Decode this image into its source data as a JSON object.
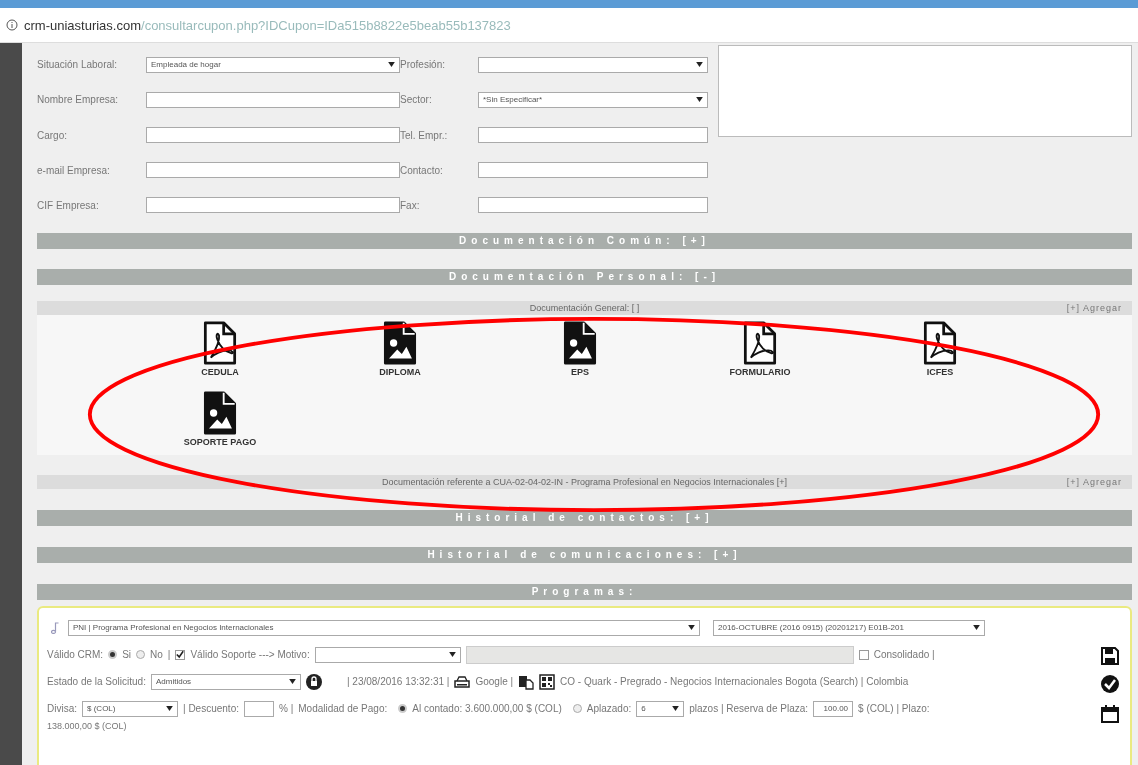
{
  "address_bar": {
    "domain": "crm-uniasturias.com",
    "path": "/consultarcupon.php?IDCupon=IDa515b8822e5beab55b137823"
  },
  "employment_form": {
    "rows": [
      {
        "left": {
          "label": "Situación Laboral:",
          "kind": "select",
          "value": "Empleada de hogar"
        },
        "right": {
          "label": "Profesión:",
          "kind": "select"
        }
      },
      {
        "left": {
          "label": "Nombre Empresa:",
          "kind": "input"
        },
        "right": {
          "label": "Sector:",
          "kind": "select",
          "value": "*Sin Especificar*"
        }
      },
      {
        "left": {
          "label": "Cargo:",
          "kind": "input"
        },
        "right": {
          "label": "Tel. Empr.:",
          "kind": "input"
        }
      },
      {
        "left": {
          "label": "e-mail Empresa:",
          "kind": "input"
        },
        "right": {
          "label": "Contacto:",
          "kind": "input"
        }
      },
      {
        "left": {
          "label": "CIF Empresa:",
          "kind": "input"
        },
        "right": {
          "label": "Fax:",
          "kind": "input"
        }
      }
    ]
  },
  "sections_top": [
    {
      "title": "Documentación Común: [+]"
    },
    {
      "title": "Documentación Personal: [-]"
    }
  ],
  "general_docs": {
    "title": "Documentación General: [ ]",
    "add_link": "[+] Agregar",
    "documents": [
      {
        "name": "CEDULA",
        "kind": "pdf"
      },
      {
        "name": "DIPLOMA",
        "kind": "image"
      },
      {
        "name": "EPS",
        "kind": "image"
      },
      {
        "name": "FORMULARIO",
        "kind": "pdf"
      },
      {
        "name": "ICFES",
        "kind": "pdf"
      },
      {
        "name": "SOPORTE PAGO",
        "kind": "image"
      }
    ]
  },
  "program_docs": {
    "title": "Documentación referente a CUA-02-04-02-IN - Programa Profesional en Negocios Internacionales [+]",
    "add_link": "[+] Agregar"
  },
  "sections_bottom": [
    {
      "title": "Historial de contactos: [+]"
    },
    {
      "title": "Historial de comunicaciones: [+]"
    },
    {
      "title": "Programas:"
    }
  ],
  "program": {
    "program_select": "PNI | Programa Profesional en Negocios Internacionales",
    "period_select": "2016-OCTUBRE (2016 0915) (20201217) E01B-201",
    "valid_crm": {
      "label": "Válido CRM:",
      "options": [
        {
          "label": "Si",
          "selected": true
        },
        {
          "label": "No",
          "selected": false
        }
      ]
    },
    "separator": "|",
    "valid_support": {
      "label": "Válido Soporte ---> Motivo:",
      "checked": true
    },
    "consolidated": {
      "label": "Consolidado |",
      "checked": false
    },
    "status": {
      "label": "Estado de la Solicitud:",
      "value": "Admitidos"
    },
    "timestamp": "| 23/08/2016 13:32:31 |",
    "source": "Google |",
    "campaign": "CO - Quark - Pregrado - Negocios Internacionales Bogota (Search) | Colombia",
    "currency": {
      "label": "Divisa:",
      "value": "$ (COL)"
    },
    "discount": {
      "label": "| Descuento:",
      "unit": "% |"
    },
    "payment": {
      "label": "Modalidad de Pago:",
      "options": [
        {
          "label": "Al contado: 3.600.000,00 $ (COL)",
          "selected": true
        },
        {
          "label": "Aplazado:",
          "selected": false
        }
      ]
    },
    "installments": {
      "value": "6",
      "label": "plazos | Reserva de Plaza:"
    },
    "reservation": {
      "value": "100.00",
      "unit": "$ (COL) | Plazo:"
    },
    "overflow_line": "138.000,00 $ (COL)"
  }
}
